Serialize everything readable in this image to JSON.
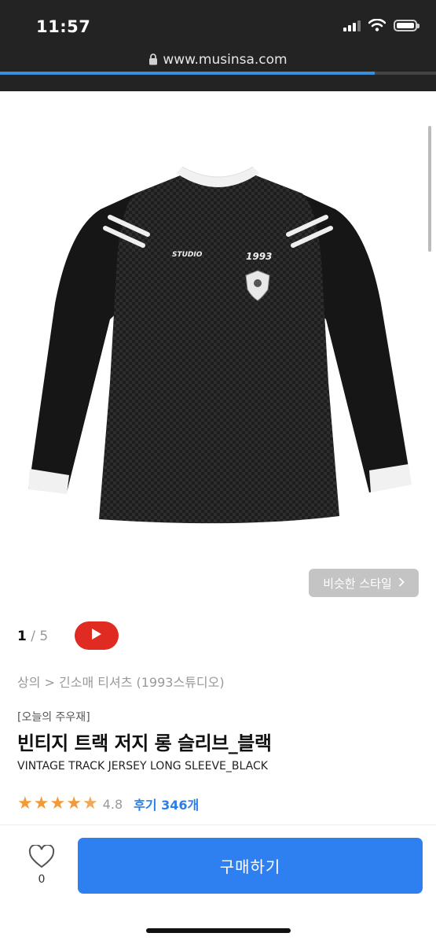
{
  "status_bar": {
    "time": "11:57"
  },
  "browser": {
    "url": "www.musinsa.com",
    "load_progress": 0.86
  },
  "product": {
    "similar_style_label": "비슷한 스타일",
    "pager": {
      "current": "1",
      "separator": " / ",
      "total": "5"
    },
    "breadcrumb": "상의 > 긴소매 티셔츠 (1993스튜디오)",
    "promo_tag": "[오늘의 주우재]",
    "title_ko": "빈티지 트랙 저지 롱 슬리브_블랙",
    "title_en": "VINTAGE TRACK JERSEY LONG SLEEVE_BLACK",
    "rating": {
      "stars": 4.8,
      "score": "4.8",
      "reviews_label": "후기 346개"
    },
    "jersey_prints": {
      "chest_left": "STUDIO",
      "chest_right": "1993"
    }
  },
  "bottom_bar": {
    "like_count": "0",
    "buy_label": "구매하기"
  },
  "colors": {
    "buy_button": "#2e80f0",
    "star": "#f29a3a",
    "video": "#e02b22",
    "review_link": "#2b7de9"
  }
}
